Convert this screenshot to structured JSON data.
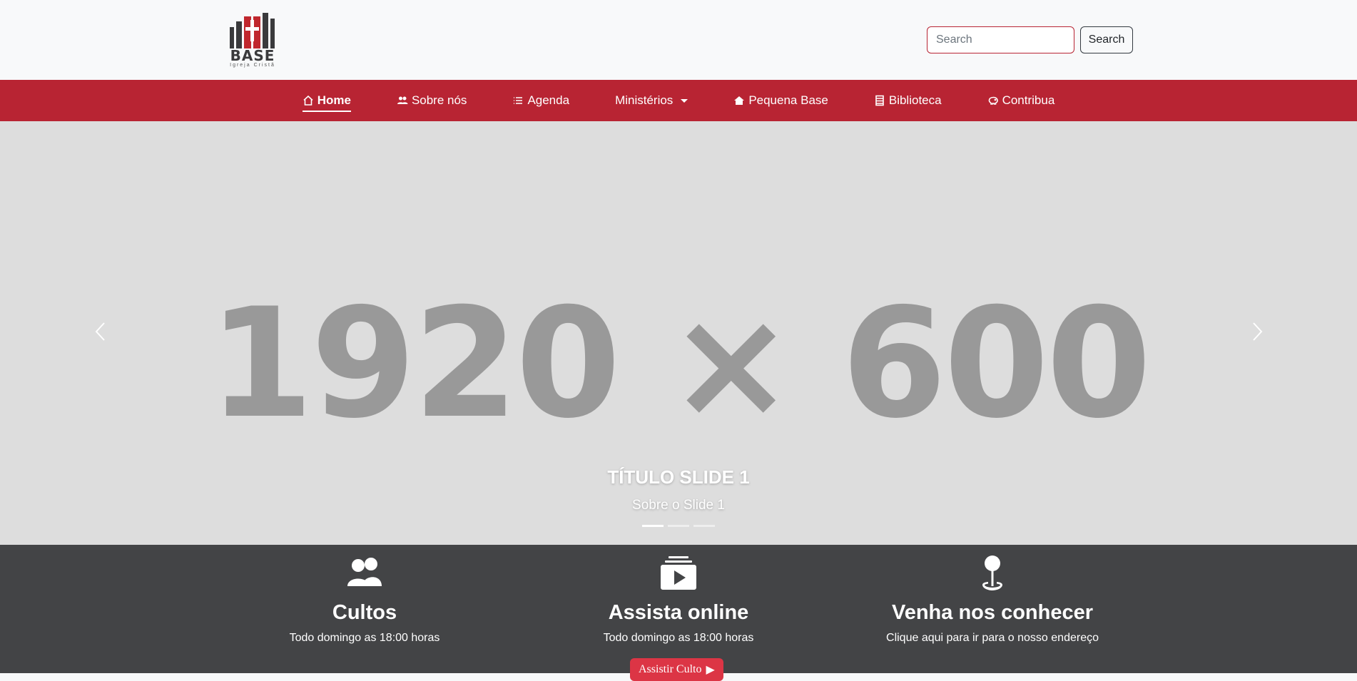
{
  "logo": {
    "name": "BASE",
    "tagline": "Igreja Cristã"
  },
  "search": {
    "placeholder": "Search",
    "button_label": "Search"
  },
  "nav": {
    "items": [
      {
        "label": "Home",
        "icon": "house-icon",
        "active": true
      },
      {
        "label": "Sobre nós",
        "icon": "people-icon"
      },
      {
        "label": "Agenda",
        "icon": "list-icon"
      },
      {
        "label": "Ministérios",
        "icon": "",
        "dropdown": true
      },
      {
        "label": "Pequena Base",
        "icon": "house-fill-icon"
      },
      {
        "label": "Biblioteca",
        "icon": "book-icon"
      },
      {
        "label": "Contribua",
        "icon": "piggy-bank-icon"
      }
    ]
  },
  "carousel": {
    "placeholder": "1920 × 600",
    "title": "TÍTULO SLIDE 1",
    "subtitle": "Sobre o Slide 1",
    "slide_count": 3,
    "active_index": 0
  },
  "features": [
    {
      "icon": "people-fill-icon",
      "title": "Cultos",
      "text": "Todo domingo as 18:00 horas"
    },
    {
      "icon": "collection-play-icon",
      "title": "Assista online",
      "text": "Todo domingo as 18:00 horas"
    },
    {
      "icon": "geo-pin-icon",
      "title": "Venha nos conhecer",
      "text": "Clique aqui para ir para o nosso endereço"
    }
  ],
  "watch_button": {
    "label": "Assistir Culto"
  },
  "colors": {
    "brand_red": "#b82433",
    "button_red": "#dc3545",
    "dark": "#434446",
    "carousel_bg": "#dddddd"
  }
}
